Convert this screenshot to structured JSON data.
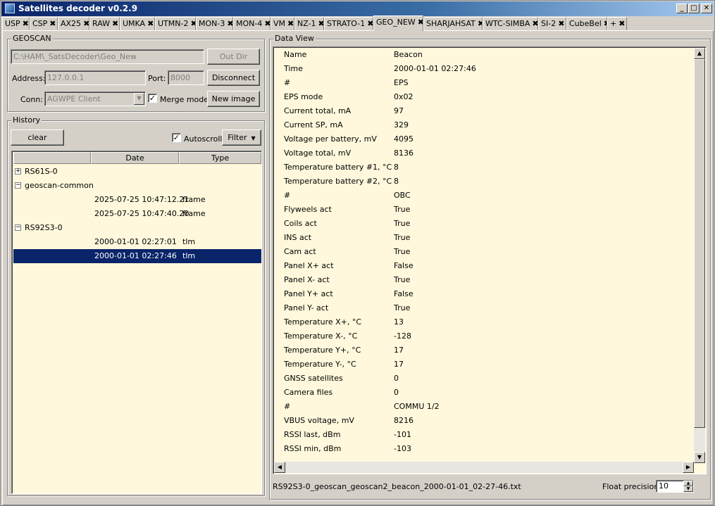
{
  "window": {
    "title": "Satellites decoder v0.2.9"
  },
  "tabs": [
    {
      "label": "USP"
    },
    {
      "label": "CSP"
    },
    {
      "label": "AX25"
    },
    {
      "label": "RAW"
    },
    {
      "label": "UMKA"
    },
    {
      "label": "UTMN-2"
    },
    {
      "label": "MON-3"
    },
    {
      "label": "MON-4"
    },
    {
      "label": "VM"
    },
    {
      "label": "NZ-1"
    },
    {
      "label": "STRATO-1"
    },
    {
      "label": "GEO_NEW"
    },
    {
      "label": "SHARJAHSAT"
    },
    {
      "label": "WTC-SIMBA"
    },
    {
      "label": "SI-2"
    },
    {
      "label": "CubeBel"
    },
    {
      "label": "+"
    }
  ],
  "tab_close_glyph": "✖",
  "geoscan": {
    "legend": "GEOSCAN",
    "out_dir_value": "C:\\HAM\\_SatsDecoder\\Geo_New",
    "out_dir_button": "Out Dir",
    "address_label": "Address:",
    "address_value": "127.0.0.1",
    "port_label": "Port:",
    "port_value": "8000",
    "disconnect_button": "Disconnect",
    "conn_label": "Conn:",
    "conn_value": "AGWPE Client",
    "merge_mode_label": "Merge mode",
    "merge_mode_checked": "✓",
    "new_image_button": "New image"
  },
  "history": {
    "legend": "History",
    "clear_button": "clear",
    "autoscroll_label": "Autoscroll",
    "autoscroll_checked": "✓",
    "filter_button": "Filter",
    "columns": [
      "",
      "Date",
      "Type"
    ],
    "rows": [
      {
        "name": "RS61S-0",
        "expander": "+",
        "date": "",
        "type": ""
      },
      {
        "name": "geoscan-common",
        "expander": "−",
        "date": "",
        "type": ""
      },
      {
        "name": "",
        "expander": "",
        "date": "2025-07-25 10:47:12.21",
        "type": "frame"
      },
      {
        "name": "",
        "expander": "",
        "date": "2025-07-25 10:47:40.20",
        "type": "frame"
      },
      {
        "name": "RS92S3-0",
        "expander": "−",
        "date": "",
        "type": ""
      },
      {
        "name": "",
        "expander": "",
        "date": "2000-01-01 02:27:01",
        "type": "tlm"
      },
      {
        "name": "",
        "expander": "",
        "date": "2000-01-01 02:27:46",
        "type": "tlm"
      }
    ]
  },
  "data_view": {
    "legend": "Data View",
    "rows": [
      {
        "k": "Name",
        "v": "Beacon"
      },
      {
        "k": "Time",
        "v": "2000-01-01 02:27:46"
      },
      {
        "k": "#",
        "v": "EPS"
      },
      {
        "k": "EPS mode",
        "v": "0x02"
      },
      {
        "k": "Current total, mA",
        "v": "97"
      },
      {
        "k": "Current SP, mA",
        "v": "329"
      },
      {
        "k": "Voltage per battery, mV",
        "v": "4095"
      },
      {
        "k": "Voltage total, mV",
        "v": "8136"
      },
      {
        "k": "Temperature battery #1, °C",
        "v": "8"
      },
      {
        "k": "Temperature battery #2, °C",
        "v": "8"
      },
      {
        "k": "#",
        "v": "OBC"
      },
      {
        "k": "Flyweels act",
        "v": "True"
      },
      {
        "k": "Coils act",
        "v": "True"
      },
      {
        "k": "INS act",
        "v": "True"
      },
      {
        "k": "Cam act",
        "v": "True"
      },
      {
        "k": "Panel X+ act",
        "v": "False"
      },
      {
        "k": "Panel X- act",
        "v": "True"
      },
      {
        "k": "Panel Y+ act",
        "v": "False"
      },
      {
        "k": "Panel Y- act",
        "v": "True"
      },
      {
        "k": "Temperature X+, °C",
        "v": "13"
      },
      {
        "k": "Temperature X-, °C",
        "v": "-128"
      },
      {
        "k": "Temperature Y+, °C",
        "v": "17"
      },
      {
        "k": "Temperature Y-, °C",
        "v": "17"
      },
      {
        "k": "GNSS satellites",
        "v": "0"
      },
      {
        "k": "Camera files",
        "v": "0"
      },
      {
        "k": "#",
        "v": "COMMU 1/2"
      },
      {
        "k": "VBUS voltage, mV",
        "v": "8216"
      },
      {
        "k": "RSSI last, dBm",
        "v": "-101"
      },
      {
        "k": "RSSI min, dBm",
        "v": "-103"
      }
    ],
    "status_filename": "RS92S3-0_geoscan_geoscan2_beacon_2000-01-01_02-27-46.txt",
    "float_precision_label": "Float precision:",
    "float_precision_value": "10"
  },
  "colors": {
    "selection": "#0a246a",
    "panel_bg": "#fff8dc",
    "face": "#d4d0c8"
  }
}
